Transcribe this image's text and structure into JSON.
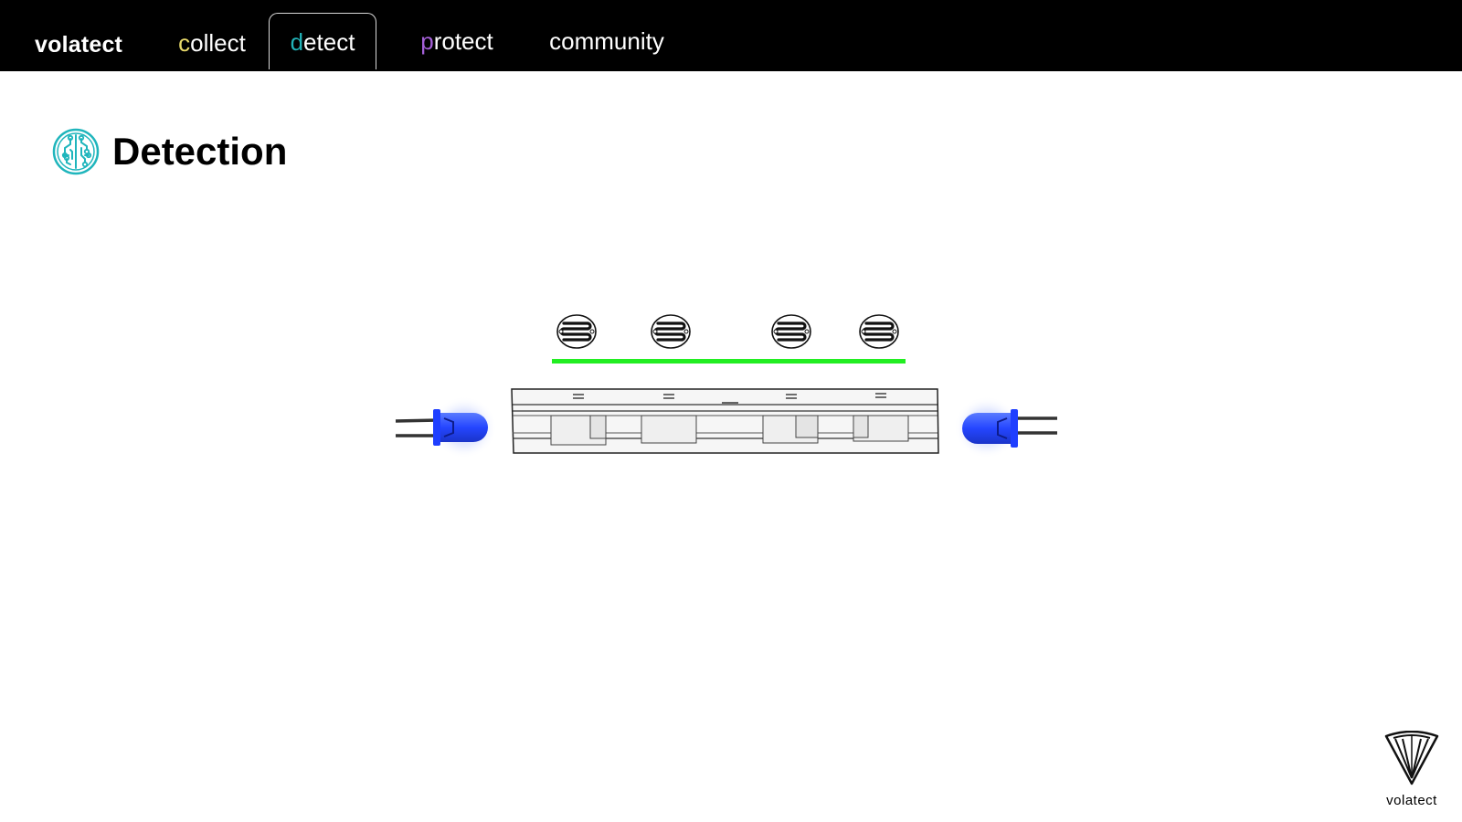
{
  "brand": "volatect",
  "nav": {
    "tabs": [
      {
        "first": "c",
        "rest": "ollect",
        "first_color": "#e8d96a"
      },
      {
        "first": "d",
        "rest": "etect",
        "first_color": "#21b3b8",
        "active": true
      },
      {
        "first": "p",
        "rest": "rotect",
        "first_color": "#a35fd6"
      },
      {
        "first": "",
        "rest": "community"
      }
    ]
  },
  "page": {
    "title": "Detection",
    "icon": "circuit-brain-icon",
    "accent_color": "#1fb5bc"
  },
  "diagram": {
    "sensors": [
      "photoresistor-icon",
      "photoresistor-icon",
      "photoresistor-icon",
      "photoresistor-icon"
    ],
    "beam_color": "#22ee22",
    "led_color": "#2f5bff",
    "leds": [
      "led-left-icon",
      "led-right-icon"
    ],
    "holder": "test-tube-rack"
  },
  "footer": {
    "logo_label": "volatect"
  }
}
